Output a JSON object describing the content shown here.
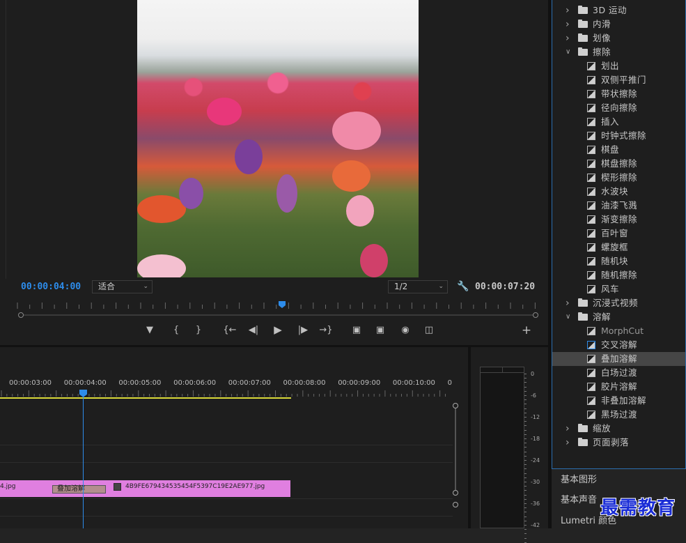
{
  "program_monitor": {
    "current_timecode": "00:00:04:00",
    "duration_timecode": "00:00:07:20",
    "fit_value": "适合",
    "resolution_value": "1/2",
    "icons": [
      "wrench-icon",
      "add-marker-icon",
      "mark-in-icon",
      "mark-out-icon",
      "go-to-in-icon",
      "step-back-icon",
      "play-icon",
      "step-forward-icon",
      "go-to-out-icon",
      "lift-icon",
      "extract-icon",
      "export-frame-icon",
      "comparison-view-icon",
      "add-button-icon"
    ]
  },
  "effects_tree": [
    {
      "type": "folder",
      "label": "3D 运动",
      "expanded": false
    },
    {
      "type": "folder",
      "label": "内滑",
      "expanded": false
    },
    {
      "type": "folder",
      "label": "划像",
      "expanded": false
    },
    {
      "type": "folder",
      "label": "擦除",
      "expanded": true
    },
    {
      "type": "effect",
      "label": "划出"
    },
    {
      "type": "effect",
      "label": "双侧平推门"
    },
    {
      "type": "effect",
      "label": "带状擦除"
    },
    {
      "type": "effect",
      "label": "径向擦除"
    },
    {
      "type": "effect",
      "label": "插入"
    },
    {
      "type": "effect",
      "label": "时钟式擦除"
    },
    {
      "type": "effect",
      "label": "棋盘"
    },
    {
      "type": "effect",
      "label": "棋盘擦除"
    },
    {
      "type": "effect",
      "label": "楔形擦除"
    },
    {
      "type": "effect",
      "label": "水波块"
    },
    {
      "type": "effect",
      "label": "油漆飞溅"
    },
    {
      "type": "effect",
      "label": "渐变擦除"
    },
    {
      "type": "effect",
      "label": "百叶窗"
    },
    {
      "type": "effect",
      "label": "螺旋框"
    },
    {
      "type": "effect",
      "label": "随机块"
    },
    {
      "type": "effect",
      "label": "随机擦除"
    },
    {
      "type": "effect",
      "label": "风车"
    },
    {
      "type": "folder",
      "label": "沉浸式视频",
      "expanded": false
    },
    {
      "type": "folder",
      "label": "溶解",
      "expanded": true
    },
    {
      "type": "effect",
      "label": "MorphCut"
    },
    {
      "type": "effect",
      "label": "交叉溶解",
      "default": true
    },
    {
      "type": "effect",
      "label": "叠加溶解",
      "selected": true
    },
    {
      "type": "effect",
      "label": "白场过渡"
    },
    {
      "type": "effect",
      "label": "胶片溶解"
    },
    {
      "type": "effect",
      "label": "非叠加溶解"
    },
    {
      "type": "effect",
      "label": "黑场过渡"
    },
    {
      "type": "folder",
      "label": "缩放",
      "expanded": false
    },
    {
      "type": "folder",
      "label": "页面剥落",
      "expanded": false
    }
  ],
  "side_panels": {
    "basic_graphics": "基本图形",
    "basic_audio": "基本声音",
    "lumetri": "Lumetri 颜色"
  },
  "watermark": "最需教育",
  "timeline": {
    "ruler_labels": [
      "00:00:03:00",
      "00:00:04:00",
      "00:00:05:00",
      "00:00:06:00",
      "00:00:07:00",
      "00:00:08:00",
      "00:00:09:00",
      "00:00:10:00",
      "0"
    ],
    "clip_left_name": "4.jpg",
    "transition_label": "叠加溶解",
    "clip_right_name": "4B9FE679434535454F5397C19E2AE977.jpg"
  },
  "audio_meter": {
    "scale": [
      "0",
      "-6",
      "-12",
      "-18",
      "-24",
      "-30",
      "-36",
      "-42"
    ]
  },
  "colors": {
    "accent": "#2d8ceb",
    "clip": "#e07fe0",
    "work_area": "#d9d93a",
    "transition": "#b38e8e"
  }
}
